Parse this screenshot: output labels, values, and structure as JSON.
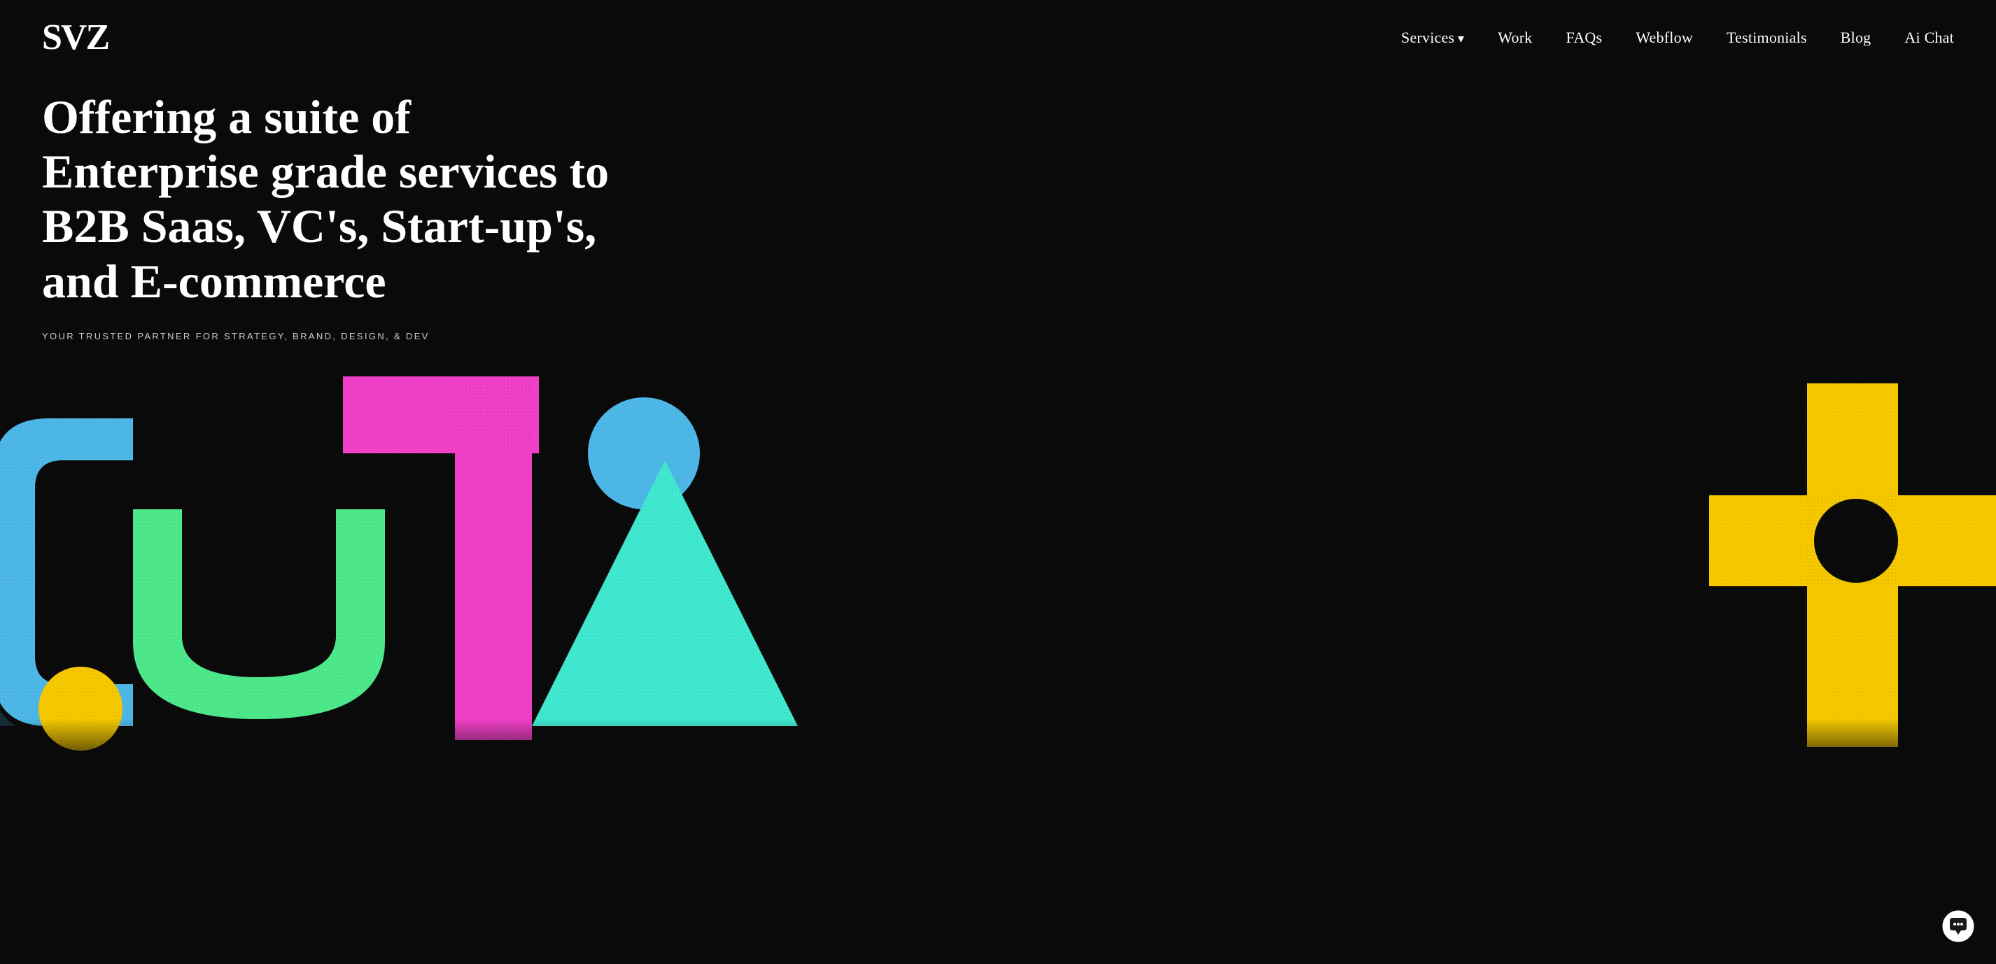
{
  "logo": {
    "text": "SVZ"
  },
  "nav": {
    "links": [
      {
        "label": "Services",
        "has_arrow": true,
        "href": "#"
      },
      {
        "label": "Work",
        "has_arrow": false,
        "href": "#"
      },
      {
        "label": "FAQs",
        "has_arrow": false,
        "href": "#"
      },
      {
        "label": "Webflow",
        "has_arrow": false,
        "href": "#"
      },
      {
        "label": "Testimonials",
        "has_arrow": false,
        "href": "#"
      },
      {
        "label": "Blog",
        "has_arrow": false,
        "href": "#"
      },
      {
        "label": "Ai Chat",
        "has_arrow": false,
        "href": "#"
      }
    ]
  },
  "hero": {
    "title": "Offering a suite of Enterprise grade services to B2B Saas, VC's, Start-up's, and E-commerce",
    "subtitle": "YOUR TRUSTED PARTNER FOR STRATEGY, BRAND, DESIGN, & DEV"
  },
  "colors": {
    "blue": "#4db8e8",
    "green": "#4de88a",
    "pink": "#f040c8",
    "yellow": "#f5c800",
    "teal": "#40e8d0",
    "black": "#0a0a0a",
    "white": "#ffffff"
  },
  "chat_icon": "💬"
}
